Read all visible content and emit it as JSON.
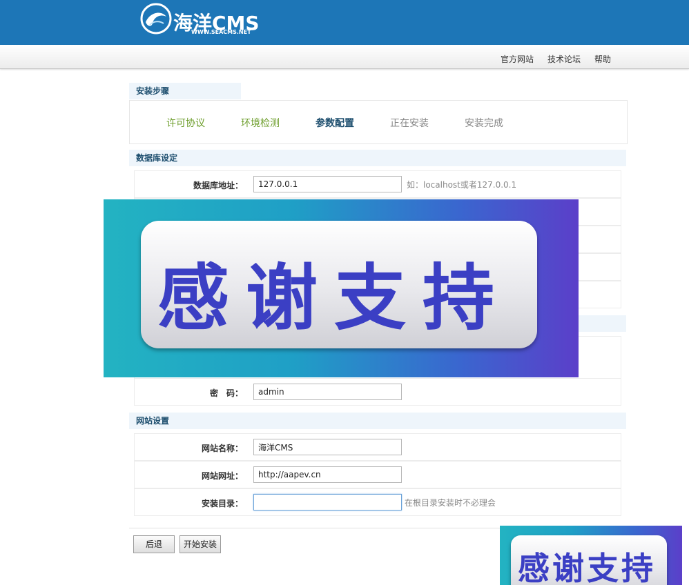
{
  "header": {
    "logo_text": "海洋CMS",
    "logo_url": "WWW.SEACMS.NET",
    "nav": [
      "官方网站",
      "技术论坛",
      "帮助"
    ]
  },
  "steps": {
    "title": "安装步骤",
    "items": [
      "许可协议",
      "环境检测",
      "参数配置",
      "正在安装",
      "安装完成"
    ]
  },
  "db": {
    "title": "数据库设定",
    "host_label": "数据库地址：",
    "host_value": "127.0.0.1",
    "host_hint": "如：localhost或者127.0.0.1"
  },
  "admin": {
    "password_label": "密　码：",
    "password_value": "admin"
  },
  "site": {
    "title": "网站设置",
    "name_label": "网站名称：",
    "name_value": "海洋CMS",
    "url_label": "网站网址：",
    "url_value": "http://aapev.cn",
    "dir_label": "安装目录：",
    "dir_value": "",
    "dir_hint": "在根目录安装时不必理会"
  },
  "buttons": {
    "back": "后退",
    "start": "开始安装"
  },
  "overlay": {
    "text": "感谢支持"
  },
  "colors": {
    "header": "#1d76b7",
    "step_done": "#6c9d2a",
    "step_current": "#1d4e6e",
    "overlay_text": "#3b3fc4"
  }
}
